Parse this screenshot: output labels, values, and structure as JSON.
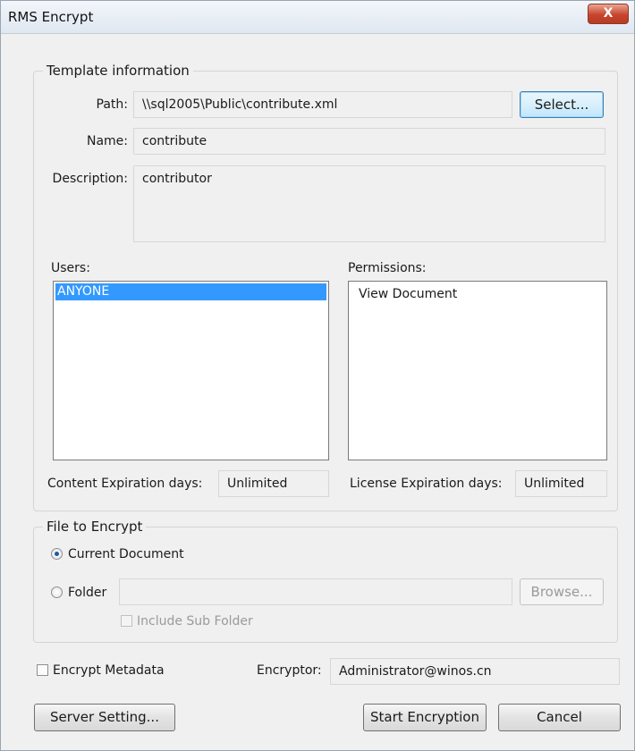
{
  "window": {
    "title": "RMS Encrypt",
    "close_glyph": "X"
  },
  "template": {
    "group_title": "Template information",
    "path_label": "Path:",
    "path_value": "\\\\sql2005\\Public\\contribute.xml",
    "select_button": "Select...",
    "name_label": "Name:",
    "name_value": "contribute",
    "description_label": "Description:",
    "description_value": "contributor",
    "users_label": "Users:",
    "users": [
      {
        "name": "ANYONE",
        "selected": true
      }
    ],
    "permissions_label": "Permissions:",
    "permissions": [
      "View Document"
    ],
    "content_expiration_label": "Content Expiration days:",
    "content_expiration_value": "Unlimited",
    "license_expiration_label": "License Expiration days:",
    "license_expiration_value": "Unlimited"
  },
  "file_to_encrypt": {
    "group_title": "File to Encrypt",
    "current_document_label": "Current Document",
    "selected_option": "Current Document",
    "folder_label": "Folder",
    "folder_value": "",
    "browse_button": "Browse...",
    "include_sub_folder_label": "Include Sub Folder",
    "include_sub_folder_checked": false
  },
  "footer": {
    "encrypt_metadata_label": "Encrypt Metadata",
    "encrypt_metadata_checked": false,
    "encryptor_label": "Encryptor:",
    "encryptor_value": "Administrator@winos.cn",
    "server_setting_button": "Server Setting...",
    "start_button": "Start Encryption",
    "cancel_button": "Cancel"
  },
  "colors": {
    "selection": "#3399ff",
    "close_button": "#c8452c",
    "dialog_bg": "#f0f0f0"
  }
}
